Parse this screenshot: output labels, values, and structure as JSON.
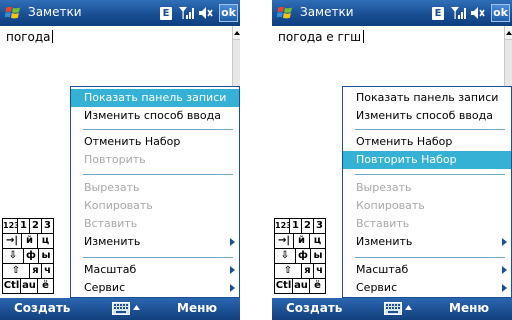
{
  "screens": [
    {
      "title": "Заметки",
      "ok_label": "ok",
      "status_letter": "E",
      "document_text": "погода",
      "keyboard": {
        "row1": [
          "123",
          "1",
          "2",
          "3"
        ],
        "row2": [
          "→|",
          "й",
          "ц"
        ],
        "row3": [
          "⇩",
          "ф",
          "ы"
        ],
        "row4": [
          "⇧",
          "я",
          "ч"
        ],
        "row5": [
          "Ctl",
          "au",
          "ё"
        ]
      },
      "menu": {
        "show_panel": "Показать панель записи",
        "change_input": "Изменить способ ввода",
        "undo": "Отменить Набор",
        "redo": "Повторить",
        "cut": "Вырезать",
        "copy": "Копировать",
        "paste": "Вставить",
        "edit": "Изменить",
        "zoom": "Масштаб",
        "service": "Сервис"
      },
      "highlighted_item": "show_panel",
      "softkey_left": "Создать",
      "softkey_right": "Меню"
    },
    {
      "title": "Заметки",
      "ok_label": "ok",
      "status_letter": "E",
      "document_text": "погода е ггш",
      "keyboard": {
        "row1": [
          "123",
          "1",
          "2",
          "3"
        ],
        "row2": [
          "→|",
          "й",
          "ц"
        ],
        "row3": [
          "⇩",
          "ф",
          "ы"
        ],
        "row4": [
          "⇧",
          "я",
          "ч"
        ],
        "row5": [
          "Ctl",
          "au",
          "ё"
        ]
      },
      "menu": {
        "show_panel": "Показать панель записи",
        "change_input": "Изменить способ ввода",
        "undo": "Отменить Набор",
        "redo": "Повторить Набор",
        "cut": "Вырезать",
        "copy": "Копировать",
        "paste": "Вставить",
        "edit": "Изменить",
        "zoom": "Масштаб",
        "service": "Сервис"
      },
      "highlighted_item": "redo",
      "softkey_left": "Создать",
      "softkey_right": "Меню"
    }
  ],
  "colors": {
    "title_bar": "#1a4f94",
    "highlight": "#35b1d6",
    "disabled_text": "#a8a8a8"
  }
}
